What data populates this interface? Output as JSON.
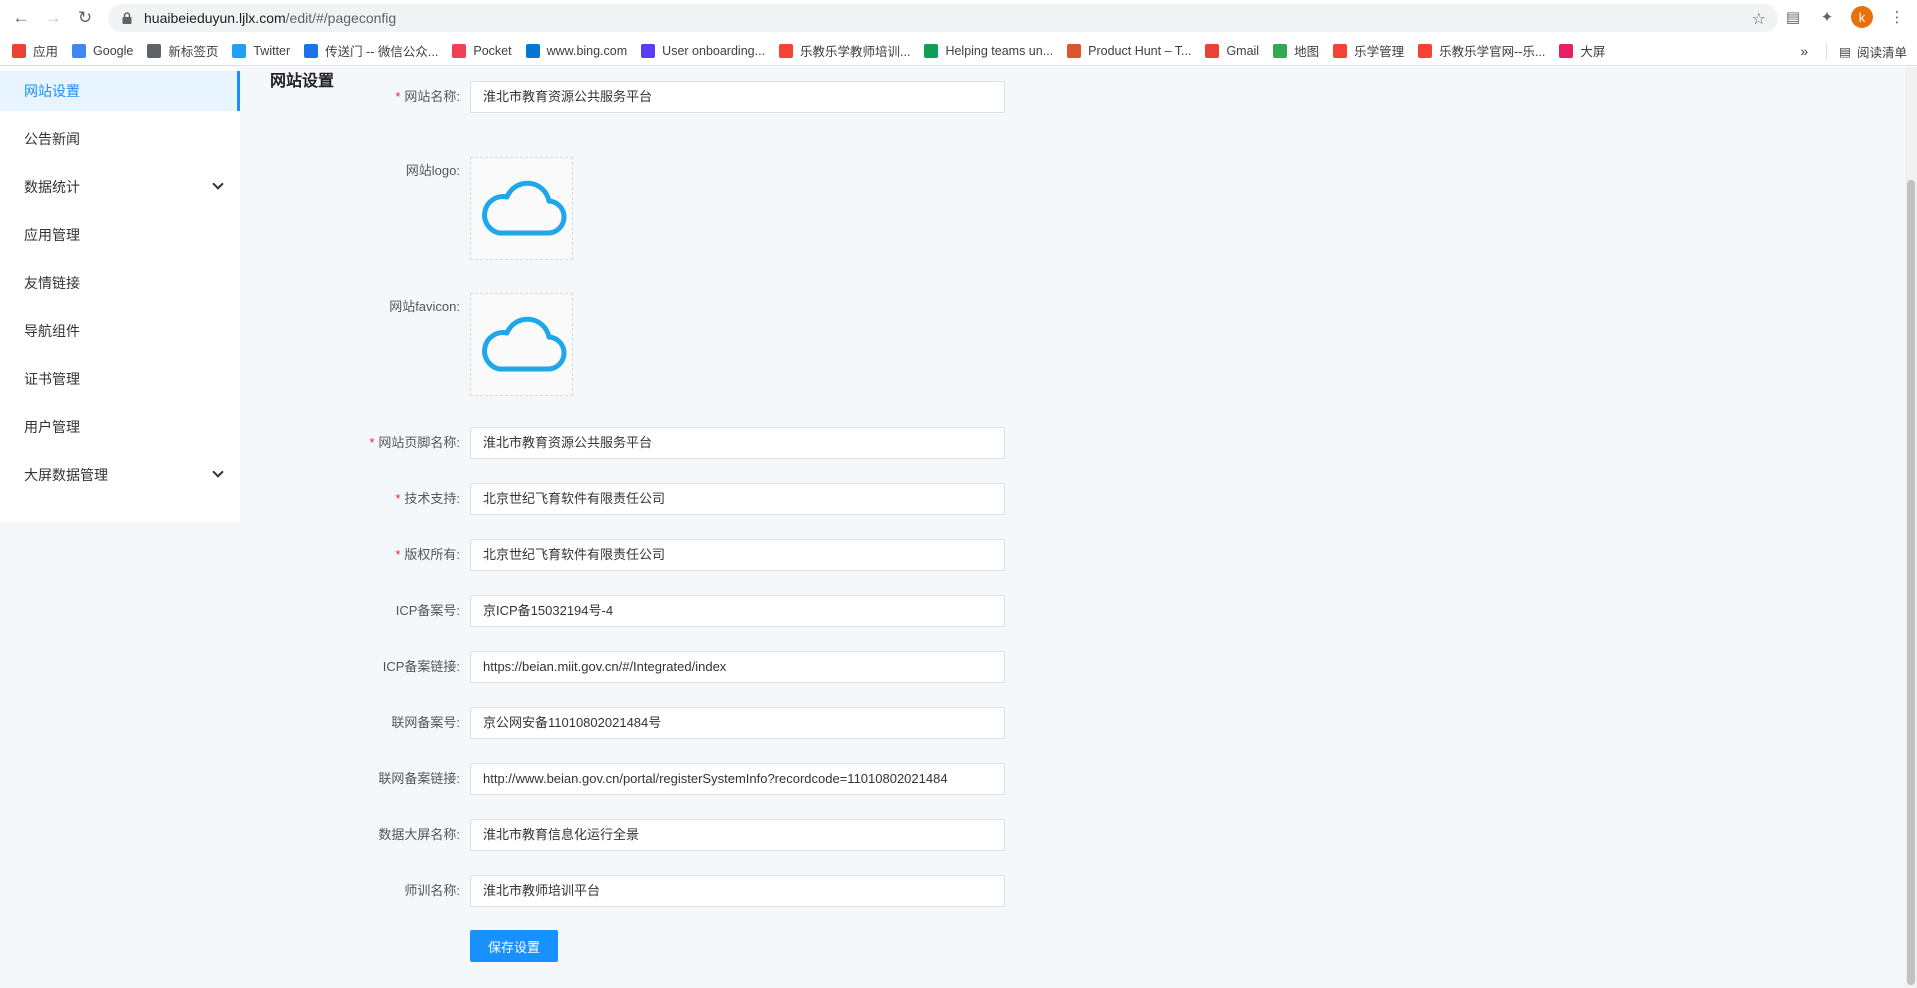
{
  "browser": {
    "url_host": "huaibeieduyun.ljlx.com",
    "url_path": "/edit/#/pageconfig",
    "profile_initial": "k",
    "bookmarks": [
      {
        "label": "应用",
        "color": "#ea4335"
      },
      {
        "label": "Google",
        "color": "#4285f4"
      },
      {
        "label": "新标签页",
        "color": "#5f6368"
      },
      {
        "label": "Twitter",
        "color": "#1da1f2"
      },
      {
        "label": "传送门 -- 微信公众...",
        "color": "#1a73e8"
      },
      {
        "label": "Pocket",
        "color": "#ef4056"
      },
      {
        "label": "www.bing.com",
        "color": "#0078d4"
      },
      {
        "label": "User onboarding...",
        "color": "#5b3df5"
      },
      {
        "label": "乐教乐学教师培训...",
        "color": "#f44336"
      },
      {
        "label": "Helping teams un...",
        "color": "#0f9d58"
      },
      {
        "label": "Product Hunt – T...",
        "color": "#da552f"
      },
      {
        "label": "Gmail",
        "color": "#ea4335"
      },
      {
        "label": "地图",
        "color": "#34a853"
      },
      {
        "label": "乐学管理",
        "color": "#f44336"
      },
      {
        "label": "乐教乐学官网--乐...",
        "color": "#f44336"
      },
      {
        "label": "大屏",
        "color": "#e91e63"
      }
    ],
    "reading_list": "阅读清单"
  },
  "sidebar": {
    "items": [
      {
        "label": "网站设置",
        "active": true,
        "expandable": false
      },
      {
        "label": "公告新闻",
        "active": false,
        "expandable": false
      },
      {
        "label": "数据统计",
        "active": false,
        "expandable": true
      },
      {
        "label": "应用管理",
        "active": false,
        "expandable": false
      },
      {
        "label": "友情链接",
        "active": false,
        "expandable": false
      },
      {
        "label": "导航组件",
        "active": false,
        "expandable": false
      },
      {
        "label": "证书管理",
        "active": false,
        "expandable": false
      },
      {
        "label": "用户管理",
        "active": false,
        "expandable": false
      },
      {
        "label": "大屏数据管理",
        "active": false,
        "expandable": true
      }
    ]
  },
  "main": {
    "title": "网站设置",
    "fields": [
      {
        "label": "网站名称:",
        "required": true,
        "value": "淮北市教育资源公共服务平台"
      },
      {
        "label": "网站logo:",
        "required": false,
        "type": "upload"
      },
      {
        "label": "网站favicon:",
        "required": false,
        "type": "upload"
      },
      {
        "label": "网站页脚名称:",
        "required": true,
        "value": "淮北市教育资源公共服务平台"
      },
      {
        "label": "技术支持:",
        "required": true,
        "value": "北京世纪飞育软件有限责任公司"
      },
      {
        "label": "版权所有:",
        "required": true,
        "value": "北京世纪飞育软件有限责任公司"
      },
      {
        "label": "ICP备案号:",
        "required": false,
        "value": "京ICP备15032194号-4"
      },
      {
        "label": "ICP备案链接:",
        "required": false,
        "value": "https://beian.miit.gov.cn/#/Integrated/index"
      },
      {
        "label": "联网备案号:",
        "required": false,
        "value": "京公网安备11010802021484号"
      },
      {
        "label": "联网备案链接:",
        "required": false,
        "value": "http://www.beian.gov.cn/portal/registerSystemInfo?recordcode=11010802021484"
      },
      {
        "label": "数据大屏名称:",
        "required": false,
        "value": "淮北市教育信息化运行全景"
      },
      {
        "label": "师训名称:",
        "required": false,
        "value": "淮北市教师培训平台"
      }
    ],
    "save_label": "保存设置"
  },
  "colors": {
    "accent": "#1890ff",
    "cloud": "#1ea7ea",
    "required": "#f5222d"
  }
}
